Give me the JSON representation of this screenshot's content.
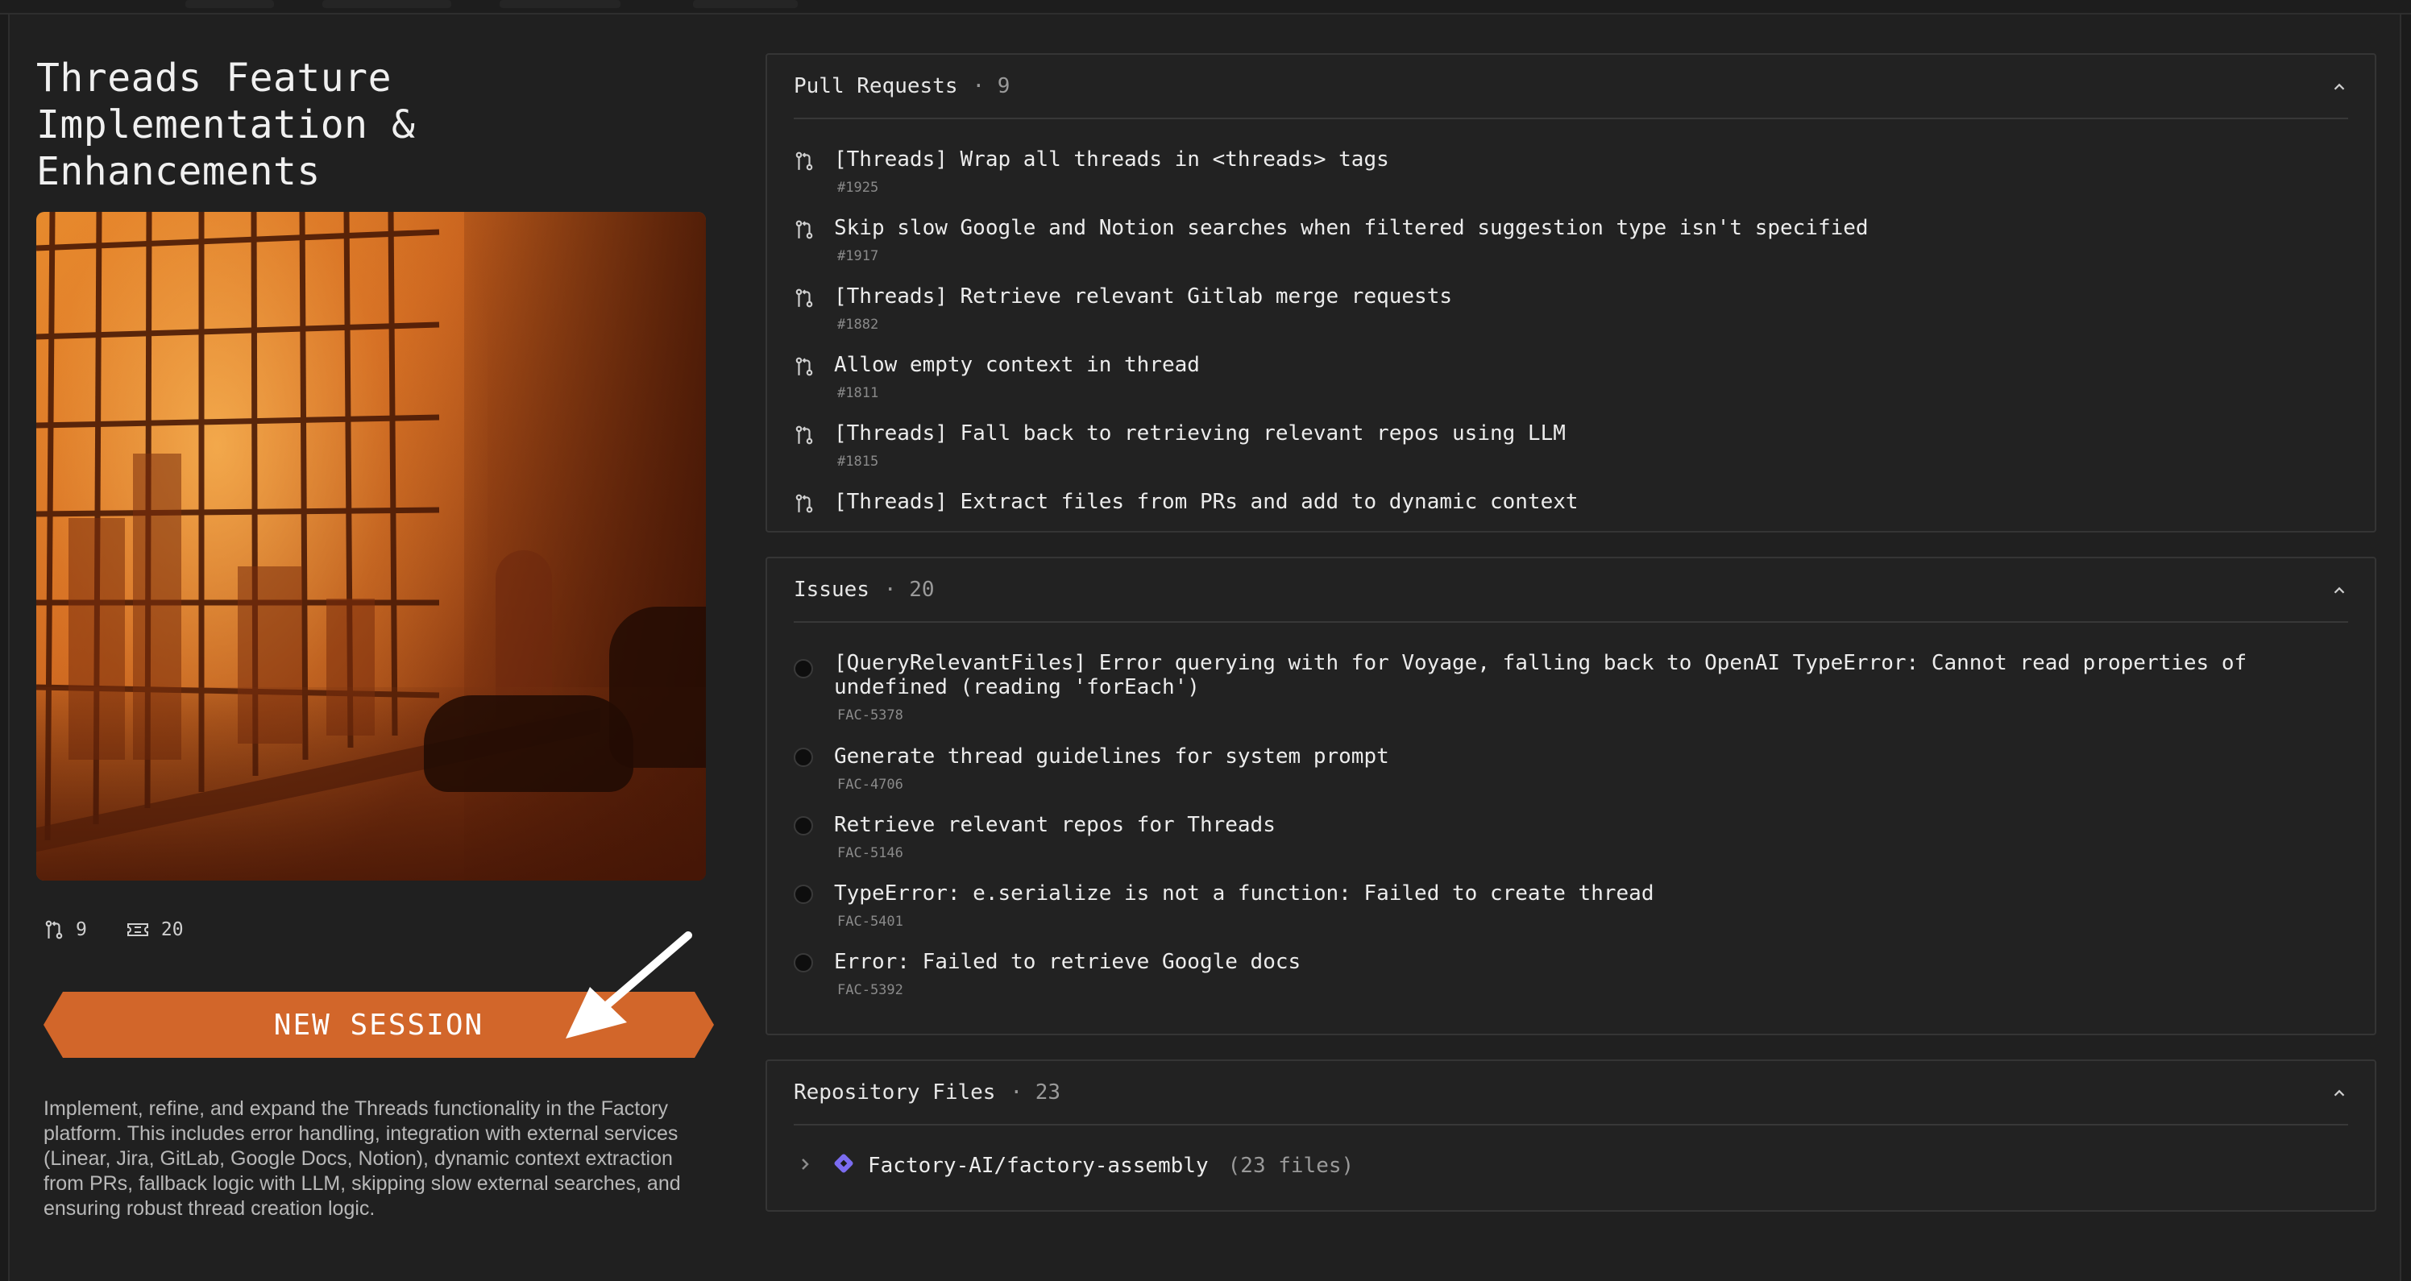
{
  "project": {
    "title": "Threads Feature Implementation & Enhancements",
    "description": "Implement, refine, and expand the Threads functionality in the Factory platform. This includes error handling, integration with external services (Linear, Jira, GitLab, Google Docs, Notion), dynamic context extraction from PRs, fallback logic with LLM, skipping slow external searches, and ensuring robust thread creation logic.",
    "stats": {
      "pr_count": "9",
      "issue_count": "20",
      "pr_icon": "git-pull-request-icon",
      "issue_icon": "ticket-icon"
    },
    "new_session_label": "NEW SESSION"
  },
  "pull_requests": {
    "title": "Pull Requests",
    "count": "· 9",
    "items": [
      {
        "title": "[Threads] Wrap all threads in <threads> tags",
        "id": "#1925"
      },
      {
        "title": "Skip slow Google and Notion searches when filtered suggestion type isn't specified",
        "id": "#1917"
      },
      {
        "title": "[Threads] Retrieve relevant Gitlab merge requests",
        "id": "#1882"
      },
      {
        "title": "Allow empty context in thread",
        "id": "#1811"
      },
      {
        "title": "[Threads] Fall back to retrieving relevant repos using LLM",
        "id": "#1815"
      },
      {
        "title": "[Threads] Extract files from PRs and add to dynamic context",
        "id": ""
      }
    ]
  },
  "issues": {
    "title": "Issues",
    "count": "· 20",
    "items": [
      {
        "title": "[QueryRelevantFiles] Error querying with for Voyage, falling back to OpenAI TypeError: Cannot read properties of undefined (reading 'forEach')",
        "id": "FAC-5378"
      },
      {
        "title": "Generate thread guidelines for system prompt",
        "id": "FAC-4706"
      },
      {
        "title": "Retrieve relevant repos for Threads",
        "id": "FAC-5146"
      },
      {
        "title": "TypeError: e.serialize is not a function: Failed to create thread",
        "id": "FAC-5401"
      },
      {
        "title": "Error: Failed to retrieve Google docs",
        "id": "FAC-5392"
      }
    ]
  },
  "repository_files": {
    "title": "Repository Files",
    "count": "· 23",
    "repo": {
      "name": "Factory-AI/factory-assembly",
      "file_count": "(23 files)",
      "icon": "repo-diamond-icon"
    }
  },
  "colors": {
    "accent": "#d2662a",
    "background": "#202020",
    "card_border": "#353535",
    "repo_icon": "#7b6cf0"
  }
}
